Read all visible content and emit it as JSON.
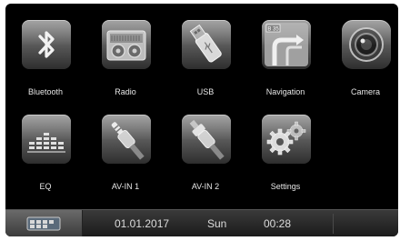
{
  "apps": {
    "bluetooth": {
      "label": "Bluetooth",
      "icon": "bluetooth-icon"
    },
    "radio": {
      "label": "Radio",
      "icon": "radio-icon"
    },
    "usb": {
      "label": "USB",
      "icon": "usb-icon"
    },
    "navigation": {
      "label": "Navigation",
      "icon": "navigation-icon",
      "sign_text": "B 35"
    },
    "camera": {
      "label": "Camera",
      "icon": "camera-icon"
    },
    "eq": {
      "label": "EQ",
      "icon": "equalizer-icon"
    },
    "av_in_1": {
      "label": "AV-IN 1",
      "icon": "av-cable-icon"
    },
    "av_in_2": {
      "label": "AV-IN 2",
      "icon": "rca-cable-icon"
    },
    "settings": {
      "label": "Settings",
      "icon": "gears-icon"
    }
  },
  "statusbar": {
    "date": "01.01.2017",
    "day": "Sun",
    "time": "00:28",
    "home_icon": "home-icon"
  }
}
